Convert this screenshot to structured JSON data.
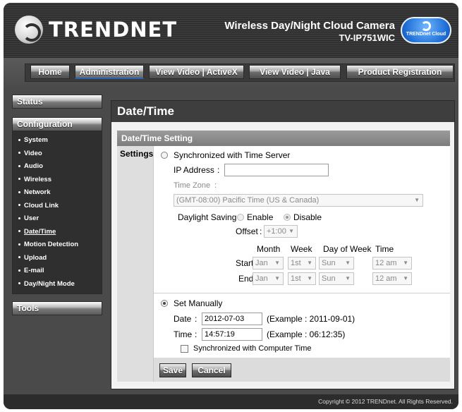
{
  "brand": {
    "logo": "TRENDNET",
    "product_name": "Wireless Day/Night Cloud Camera",
    "model": "TV-IP751WIC",
    "cloud_badge": "TRENDnet Cloud"
  },
  "nav": [
    "Home",
    "Administration",
    "View Video | ActiveX",
    "View Video | Java",
    "Product Registration"
  ],
  "sidebar": {
    "status": "Status",
    "configuration": "Configuration",
    "items": [
      "System",
      "Video",
      "Audio",
      "Wireless",
      "Network",
      "Cloud Link",
      "User",
      "Date/Time",
      "Motion Detection",
      "Upload",
      "E-mail",
      "Day/Night Mode"
    ],
    "current": "Date/Time",
    "tools": "Tools"
  },
  "page_title": "Date/Time",
  "section_title": "Date/Time Setting",
  "settings_label": "Settings",
  "time_server": {
    "label": "Synchronized with Time Server",
    "ip_label": "IP Address",
    "ip_value": "",
    "tz_label": "Time Zone",
    "tz_value": "(GMT-08:00) Pacific Time (US & Canada)",
    "dst_label": "Daylight Saving",
    "enable": "Enable",
    "disable": "Disable",
    "offset_label": "Offset",
    "offset_value": "+1:00",
    "cols": [
      "Month",
      "Week",
      "Day of Week",
      "Time"
    ],
    "start_label": "Start",
    "end_label": "End",
    "start": [
      "Jan",
      "1st",
      "Sun",
      "12 am"
    ],
    "end": [
      "Jan",
      "1st",
      "Sun",
      "12 am"
    ]
  },
  "manual": {
    "label": "Set Manually",
    "date_label": "Date",
    "date_value": "2012-07-03",
    "date_example": "(Example : 2011-09-01)",
    "time_label": "Time",
    "time_value": "14:57:19",
    "time_example": "(Example : 06:12:35)",
    "sync_pc_label": "Synchronized with Computer Time"
  },
  "buttons": {
    "save": "Save",
    "cancel": "Cancel"
  },
  "footer": "Copyright © 2012 TRENDnet.  All Rights Reserved."
}
